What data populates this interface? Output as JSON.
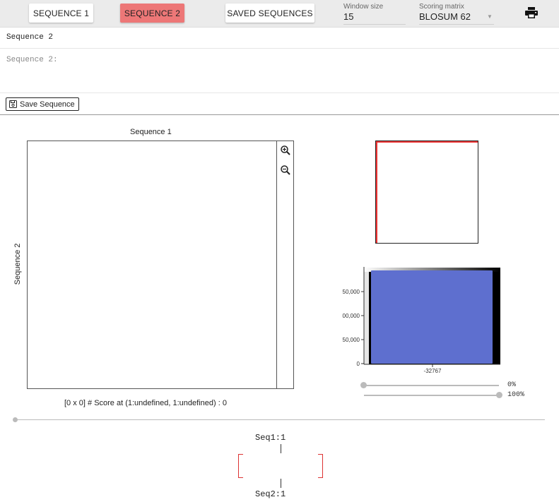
{
  "toolbar": {
    "tab_seq1": "SEQUENCE 1",
    "tab_seq2": "SEQUENCE 2",
    "tab_saved": "SAVED SEQUENCES",
    "window_size_label": "Window size",
    "window_size_value": "15",
    "scoring_label": "Scoring matrix",
    "scoring_value": "BLOSUM 62",
    "active_tab_color": "#ed7777"
  },
  "sequence_panel": {
    "name": "Sequence 2",
    "body": "Sequence 2:",
    "save_label": "Save Sequence"
  },
  "plot": {
    "title": "Sequence 1",
    "ylabel": "Sequence 2",
    "status": "[0 x 0] # Score at (1:undefined, 1:undefined) : 0"
  },
  "histogram": {
    "y_ticks": [
      "50,000",
      "00,000",
      "50,000",
      "0"
    ],
    "x_tick": "-32767",
    "bar_color": "#5e6fcf"
  },
  "sliders": {
    "lower_label": "0%",
    "upper_label": "100%",
    "lower_value": 0,
    "upper_value": 100
  },
  "alignment": {
    "seq1_label": "Seq1:1",
    "seq2_label": "Seq2:1"
  }
}
